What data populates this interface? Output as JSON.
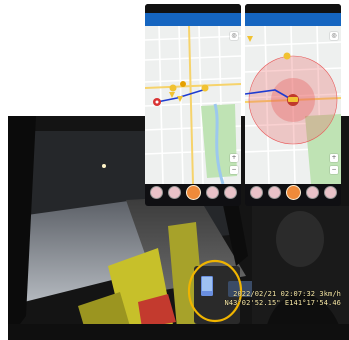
{
  "overlay": {
    "line1": "2022/02/21  02:07:32    3km/h",
    "line2": "N43°02'52.15\"  E141°17'54.46"
  },
  "colors": {
    "appbar": "#1565c0",
    "highlight_ring": "#f0b400",
    "route_line": "#1e3cd0",
    "alert_zone": "#e85a5a",
    "active_button": "#ee8a3a"
  }
}
